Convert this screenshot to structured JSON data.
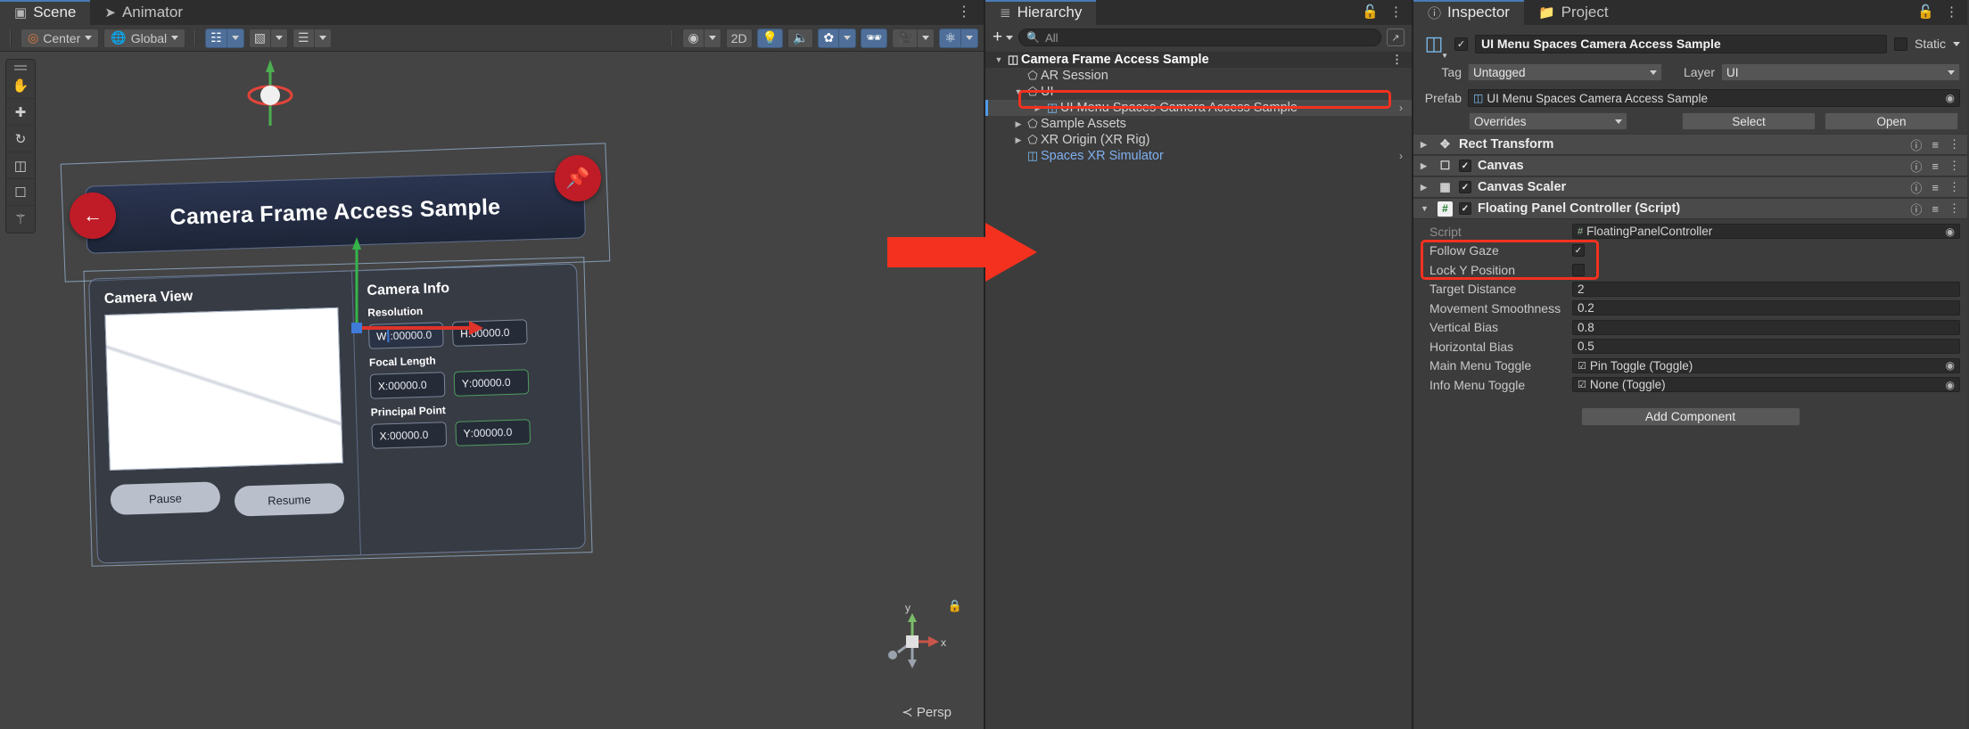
{
  "scene": {
    "tabs": [
      {
        "label": "Scene",
        "icon": "grid-icon",
        "active": true
      },
      {
        "label": "Animator",
        "icon": "animator-icon",
        "active": false
      }
    ],
    "kebab": "⋮",
    "toolbar": {
      "pivot_label": "Center",
      "handle_label": "Global",
      "mode_2d": "2D",
      "icons": [
        "pivot-icon",
        "globe-icon",
        "grid-snap-icon",
        "grid-icon",
        "scale-slider-icon",
        "light-icon",
        "audio-icon",
        "fx-icon",
        "hidden-icon",
        "camera-icon",
        "gizmos-icon",
        "shading-icon"
      ]
    },
    "tools": [
      "hand-tool",
      "move-tool",
      "rotate-tool",
      "scale-tool",
      "rect-tool",
      "transform-tool"
    ],
    "gizmo": {
      "y": "y",
      "x": "x",
      "lock": "lock-icon"
    },
    "view_mode": "Persp",
    "ui_panel": {
      "title": "Camera Frame Access Sample",
      "back_icon": "←",
      "pin_icon": "📌",
      "camera_view": {
        "heading": "Camera View",
        "pause_label": "Pause",
        "resume_label": "Resume"
      },
      "camera_info": {
        "heading": "Camera Info",
        "groups": [
          {
            "label": "Resolution",
            "fields": [
              {
                "key": "W",
                "value": ":00000.0"
              },
              {
                "key": "H",
                "value": ":00000.0"
              }
            ]
          },
          {
            "label": "Focal Length",
            "fields": [
              {
                "key": "X",
                "value": ":00000.0"
              },
              {
                "key": "Y",
                "value": ":00000.0"
              }
            ]
          },
          {
            "label": "Principal Point",
            "fields": [
              {
                "key": "X",
                "value": ":00000.0"
              },
              {
                "key": "Y",
                "value": ":00000.0"
              }
            ]
          }
        ]
      }
    }
  },
  "hierarchy": {
    "tab_label": "Hierarchy",
    "tab_icon": "list-icon",
    "lock_icon": "🔓",
    "kebab": "⋮",
    "create_label": "+",
    "search": {
      "placeholder": "All",
      "value": ""
    },
    "items": [
      {
        "label": "Camera Frame Access Sample",
        "depth": 0,
        "expanded": true,
        "icon": "unity-cube-icon",
        "root": true,
        "kebab": true
      },
      {
        "label": "AR Session",
        "depth": 1,
        "expanded": null,
        "icon": "gameobject-icon"
      },
      {
        "label": "UI",
        "depth": 1,
        "expanded": true,
        "icon": "gameobject-icon"
      },
      {
        "label": "UI Menu Spaces Camera Access Sample",
        "depth": 2,
        "expanded": false,
        "icon": "prefab-icon",
        "selected": true,
        "chevron": "›",
        "highlighted": true
      },
      {
        "label": "Sample Assets",
        "depth": 1,
        "expanded": false,
        "icon": "gameobject-icon"
      },
      {
        "label": "XR Origin (XR Rig)",
        "depth": 1,
        "expanded": false,
        "icon": "gameobject-icon"
      },
      {
        "label": "Spaces XR Simulator",
        "depth": 1,
        "expanded": null,
        "icon": "prefab-icon",
        "blue": true,
        "chevron": "›"
      }
    ]
  },
  "inspector": {
    "tabs": [
      {
        "label": "Inspector",
        "icon": "info-icon",
        "active": true
      },
      {
        "label": "Project",
        "icon": "folder-icon",
        "active": false
      }
    ],
    "lock_icon": "🔓",
    "kebab": "⋮",
    "object": {
      "enabled": true,
      "name": "UI Menu Spaces Camera Access Sample",
      "static_label": "Static",
      "static_checked": false,
      "tag_label": "Tag",
      "tag_value": "Untagged",
      "layer_label": "Layer",
      "layer_value": "UI",
      "prefab_label": "Prefab",
      "prefab_value": "UI Menu Spaces Camera Access Sample",
      "overrides_label": "Overrides",
      "select_label": "Select",
      "open_label": "Open"
    },
    "components": [
      {
        "name": "Rect Transform",
        "icon": "rect-transform-icon",
        "expanded": false,
        "has_checkbox": false
      },
      {
        "name": "Canvas",
        "icon": "canvas-icon",
        "expanded": false,
        "has_checkbox": true,
        "checked": true
      },
      {
        "name": "Canvas Scaler",
        "icon": "canvas-scaler-icon",
        "expanded": false,
        "has_checkbox": true,
        "checked": true
      },
      {
        "name": "Floating Panel Controller (Script)",
        "icon": "script-icon",
        "expanded": true,
        "has_checkbox": true,
        "checked": true
      }
    ],
    "script_props": [
      {
        "label": "Script",
        "value": "FloatingPanelController",
        "type": "object",
        "dim": true
      },
      {
        "label": "Follow Gaze",
        "value": "",
        "type": "checkbox",
        "checked": true,
        "highlighted": true
      },
      {
        "label": "Lock Y Position",
        "value": "",
        "type": "checkbox",
        "checked": false,
        "highlighted": true
      },
      {
        "label": "Target Distance",
        "value": "2",
        "type": "number"
      },
      {
        "label": "Movement Smoothness",
        "value": "0.2",
        "type": "number"
      },
      {
        "label": "Vertical Bias",
        "value": "0.8",
        "type": "number"
      },
      {
        "label": "Horizontal Bias",
        "value": "0.5",
        "type": "number"
      },
      {
        "label": "Main Menu Toggle",
        "value": "Pin Toggle (Toggle)",
        "type": "object"
      },
      {
        "label": "Info Menu Toggle",
        "value": "None (Toggle)",
        "type": "object"
      }
    ],
    "add_component_label": "Add Component"
  },
  "annotations": {
    "arrow_color": "#f4311f",
    "highlight_color": "#f4311f"
  }
}
